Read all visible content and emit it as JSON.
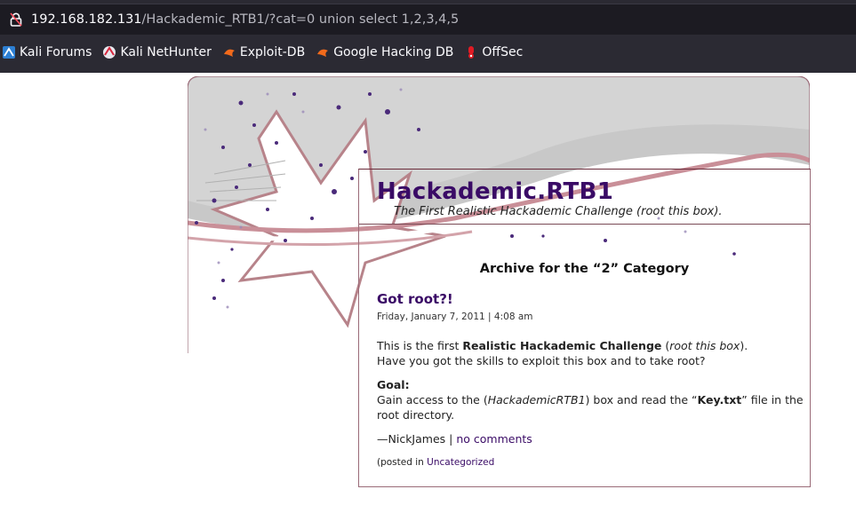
{
  "browser": {
    "url_host": "192.168.182.131",
    "url_path": "/Hackademic_RTB1/?cat=0 union select 1,2,3,4,5",
    "bookmarks": [
      {
        "label": "Kali Forums",
        "icon": "kali-dragon-icon"
      },
      {
        "label": "Kali NetHunter",
        "icon": "nethunter-icon"
      },
      {
        "label": "Exploit-DB",
        "icon": "exploitdb-icon"
      },
      {
        "label": "Google Hacking DB",
        "icon": "ghdb-icon"
      },
      {
        "label": "OffSec",
        "icon": "offsec-icon"
      }
    ]
  },
  "site": {
    "title": "Hackademic.RTB1",
    "description": "The First Realistic Hackademic Challenge (root this box)."
  },
  "archive": {
    "heading": "Archive for the “2” Category"
  },
  "post": {
    "title": "Got root?!",
    "date": "Friday, January 7, 2011 | 4:08 am",
    "p1_pre": "This is the first ",
    "p1_bold": "Realistic Hackademic Challenge",
    "p1_mid": " (",
    "p1_italic": "root this box",
    "p1_post": ").",
    "p1_line2": "Have you got the skills to exploit this box and to take root?",
    "goal_label": "Goal:",
    "goal_pre": "Gain access to the (",
    "goal_italic": "HackademicRTB1",
    "goal_mid": ") box and read the “",
    "goal_bold": "Key.txt",
    "goal_post": "” file in the root directory.",
    "author": "—NickJames",
    "sep": " | ",
    "comments_link": "no comments",
    "posted_in": "(posted in ",
    "category_link": "Uncategorized"
  }
}
